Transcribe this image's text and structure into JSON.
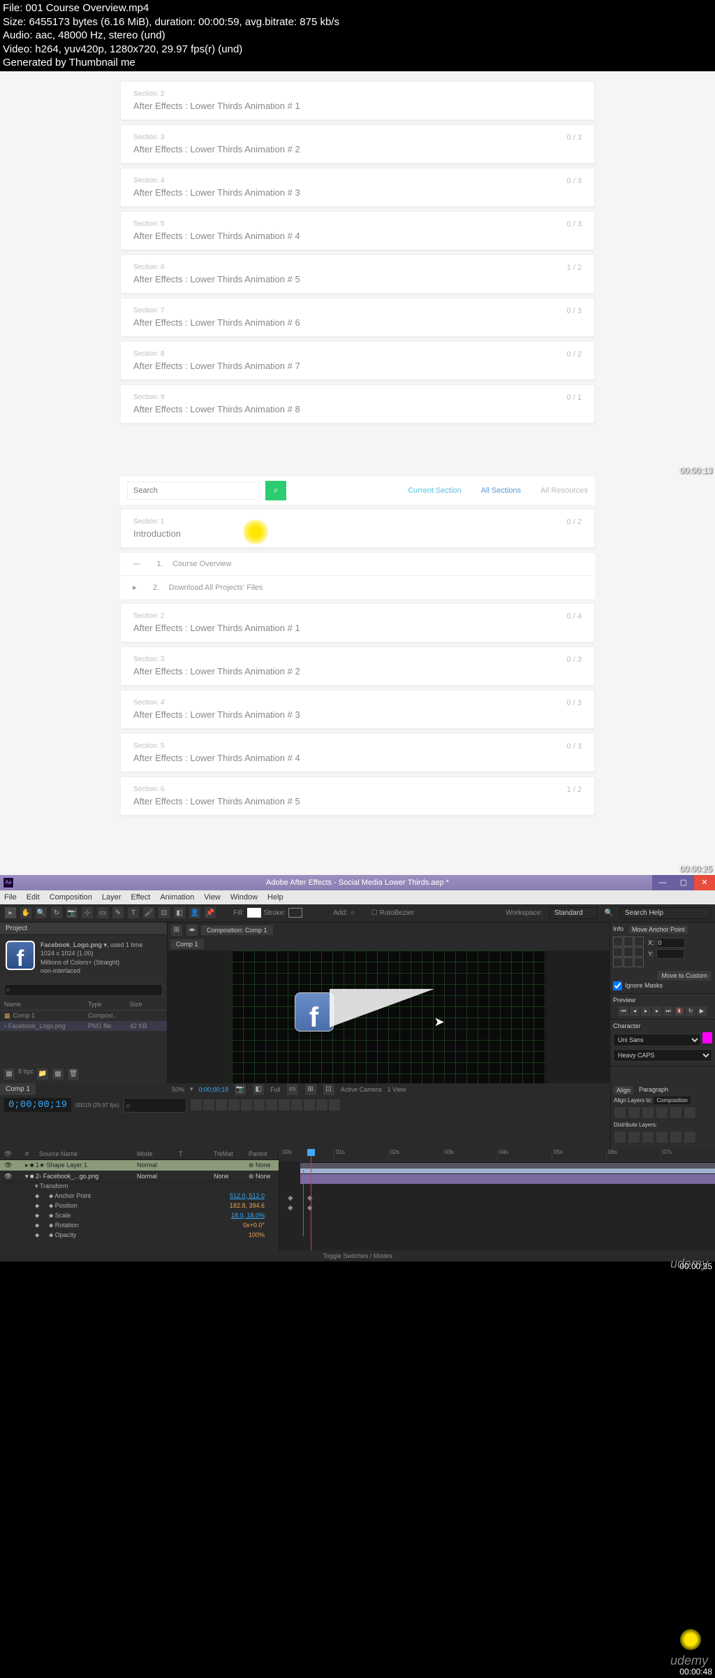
{
  "file_info": {
    "file": "File: 001 Course Overview.mp4",
    "size": "Size: 6455173 bytes (6.16 MiB), duration: 00:00:59, avg.bitrate: 875 kb/s",
    "audio": "Audio: aac, 48000 Hz, stereo (und)",
    "video": "Video: h264, yuv420p, 1280x720, 29.97 fps(r) (und)",
    "gen": "Generated by Thumbnail me"
  },
  "panel1": {
    "sections": [
      {
        "label": "Section: 2",
        "title": "After Effects : Lower Thirds Animation # 1",
        "prog": ""
      },
      {
        "label": "Section: 3",
        "title": "After Effects : Lower Thirds Animation # 2",
        "prog": "0 / 3"
      },
      {
        "label": "Section: 4",
        "title": "After Effects : Lower Thirds Animation # 3",
        "prog": "0 / 3"
      },
      {
        "label": "Section: 5",
        "title": "After Effects : Lower Thirds Animation # 4",
        "prog": "0 / 3"
      },
      {
        "label": "Section: 6",
        "title": "After Effects : Lower Thirds Animation # 5",
        "prog": "1 / 2"
      },
      {
        "label": "Section: 7",
        "title": "After Effects : Lower Thirds Animation # 6",
        "prog": "0 / 3"
      },
      {
        "label": "Section: 8",
        "title": "After Effects : Lower Thirds Animation # 7",
        "prog": "0 / 2"
      },
      {
        "label": "Section: 9",
        "title": "After Effects : Lower Thirds Animation # 8",
        "prog": "0 / 1"
      }
    ],
    "ts": "00:00:13"
  },
  "panel2": {
    "search_placeholder": "Search",
    "filters": {
      "current": "Current Section",
      "all": "All Sections",
      "res": "All Resources"
    },
    "intro": {
      "label": "Section: 1",
      "title": "Introduction",
      "prog": "0 / 2"
    },
    "items": [
      {
        "idx": "1.",
        "title": "Course Overview"
      },
      {
        "idx": "2.",
        "title": "Download All Projects' Files"
      }
    ],
    "sections": [
      {
        "label": "Section: 2",
        "title": "After Effects : Lower Thirds Animation # 1",
        "prog": "0 / 4"
      },
      {
        "label": "Section: 3",
        "title": "After Effects : Lower Thirds Animation # 2",
        "prog": "0 / 3"
      },
      {
        "label": "Section: 4",
        "title": "After Effects : Lower Thirds Animation # 3",
        "prog": "0 / 3"
      },
      {
        "label": "Section: 5",
        "title": "After Effects : Lower Thirds Animation # 4",
        "prog": "0 / 3"
      },
      {
        "label": "Section: 6",
        "title": "After Effects : Lower Thirds Animation # 5",
        "prog": "1 / 2"
      }
    ],
    "ts": "00:00:25"
  },
  "ae": {
    "title": "Adobe After Effects - Social Media Lower Thirds.aep *",
    "menus": [
      "File",
      "Edit",
      "Composition",
      "Layer",
      "Effect",
      "Animation",
      "View",
      "Window",
      "Help"
    ],
    "toolbar": {
      "stroke": "Stroke:",
      "add": "Add: ",
      "rotobezier": "RotoBezier",
      "workspace_label": "Workspace:",
      "workspace_val": "Standard",
      "search_help": "Search Help"
    },
    "project": {
      "tab": "Project",
      "filename": "Facebook_Logo.png ▾",
      "used": ", used 1 time",
      "dims": "1024 x 1024 (1.00)",
      "colors": "Millions of Colors+ (Straight)",
      "interlace": "non-interlaced",
      "cols": {
        "name": "Name",
        "type": "Type",
        "size": "Size"
      },
      "rows": [
        {
          "name": "Comp 1",
          "type": "Composi..",
          "size": ""
        },
        {
          "name": "Facebook_Logo.png",
          "type": "PNG file",
          "size": "42 KB"
        }
      ],
      "bpc": "8 bpc"
    },
    "comp": {
      "tab1": "Composition: Comp 1",
      "tab2": "Comp 1",
      "zoom": "50%",
      "time": "0;00;00;19",
      "res": "Full",
      "camera": "Active Camera",
      "view": "1 View"
    },
    "right": {
      "info_tab": "Info",
      "move_anchor": "Move Anchor Point",
      "x": "X:",
      "y": "Y:",
      "xval": "0",
      "yval": "",
      "move_custom": "Move to Custom",
      "ignore_masks": "Ignore Masks",
      "preview_tab": "Preview",
      "character_tab": "Character",
      "font": "Uni Sans",
      "weight": "Heavy CAPS"
    },
    "timeline": {
      "tab": "Comp 1",
      "timecode": "0;00;00;19",
      "frame": "00019 (29.97 fps)",
      "cols": {
        "src": "Source Name",
        "mode": "Mode",
        "trkmat": "TrkMat",
        "parent": "Parent"
      },
      "layers": [
        {
          "num": "1",
          "name": "Shape Layer 1",
          "mode": "Normal",
          "parent": "None"
        },
        {
          "num": "2",
          "name": "Facebook_...go.png",
          "mode": "Normal",
          "trkmat": "None",
          "parent": "None"
        }
      ],
      "transform": "Transform",
      "props": [
        {
          "name": "Anchor Point",
          "val": "512.0, 512.0"
        },
        {
          "name": "Position",
          "val": "182.8, 394.6"
        },
        {
          "name": "Scale",
          "val": "18.0, 18.0%"
        },
        {
          "name": "Rotation",
          "val": "0x+0.0°"
        },
        {
          "name": "Opacity",
          "val": "100%"
        }
      ],
      "ruler": [
        ":00s",
        "01s",
        "02s",
        "03s",
        "04s",
        "05s",
        "06s",
        "07s"
      ],
      "toggle": "Toggle Switches / Modes"
    },
    "align": {
      "tab1": "Align",
      "tab2": "Paragraph",
      "align_to": "Align Layers to:",
      "align_val": "Composition",
      "distribute": "Distribute Layers:"
    },
    "ts": "00:00:35",
    "udemy": "udemy"
  },
  "frame4": {
    "ts": "00:00:48",
    "udemy": "udemy"
  }
}
